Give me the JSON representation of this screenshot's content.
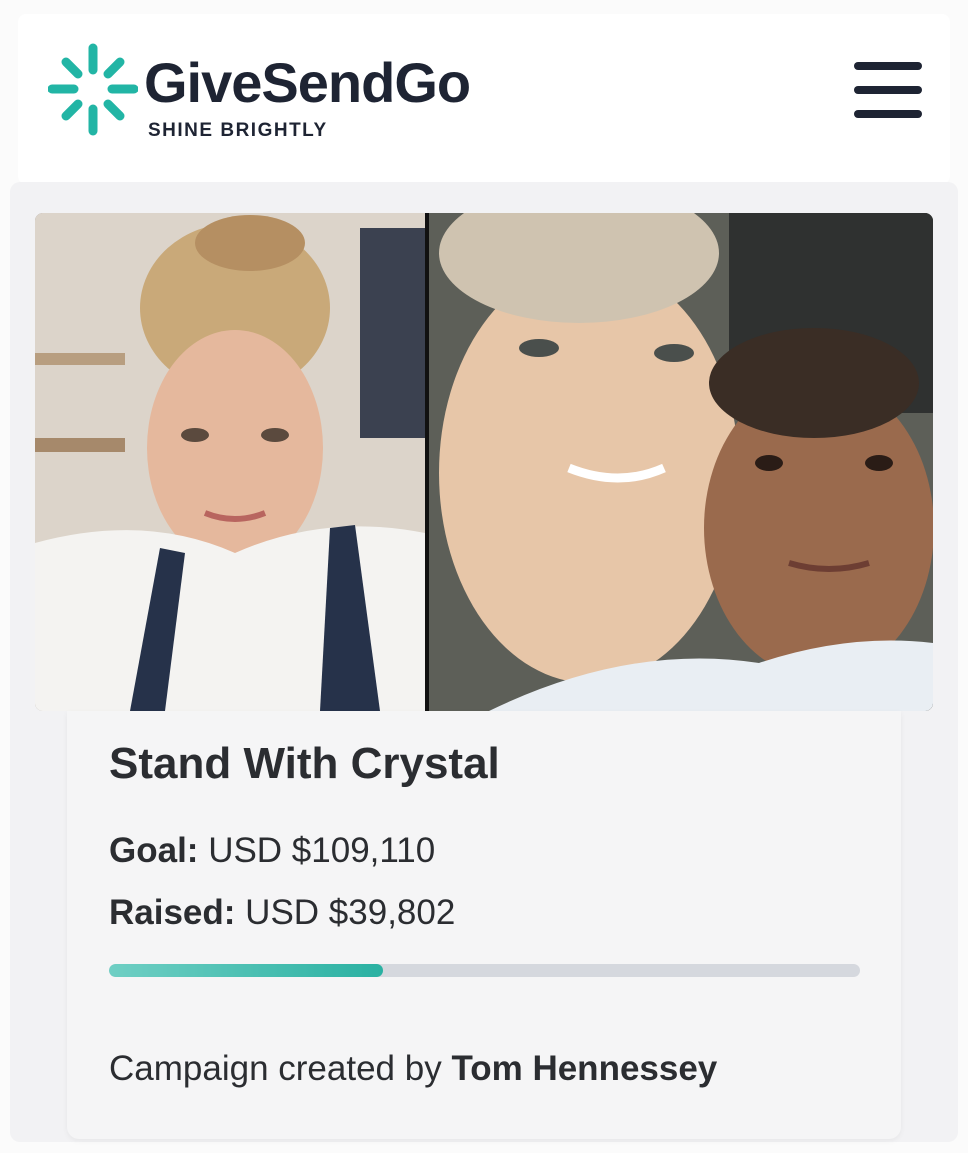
{
  "brand": {
    "name": "GiveSendGo",
    "tagline": "SHINE BRIGHTLY",
    "accent_color": "#22b5a5",
    "text_color": "#1e2433"
  },
  "header": {
    "menu_icon": "hamburger-menu-icon"
  },
  "campaign": {
    "title": "Stand With Crystal",
    "goal_label": "Goal:",
    "goal_value": "USD $109,110",
    "raised_label": "Raised:",
    "raised_value": "USD $39,802",
    "progress_fraction": 0.3648,
    "progress_color": "#2ab1a2",
    "creator_prefix": "Campaign created by",
    "creator_name": "Tom Hennessey"
  }
}
